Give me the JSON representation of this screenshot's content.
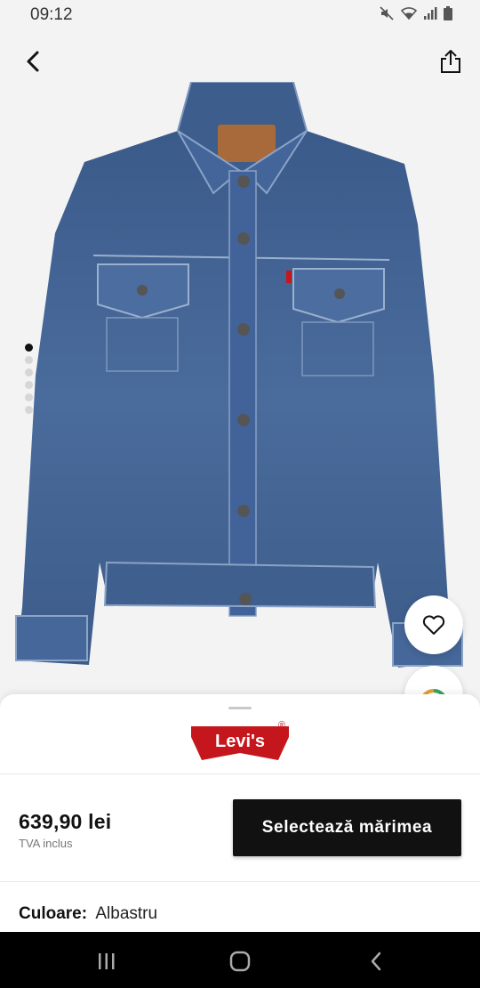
{
  "status_bar": {
    "time": "09:12",
    "icons": [
      "mute-icon",
      "wifi-icon",
      "signal-icon",
      "battery-icon"
    ]
  },
  "top_bar": {
    "back_icon": "chevron-left-icon",
    "share_icon": "share-icon"
  },
  "gallery": {
    "image_count": 6,
    "active_index": 0
  },
  "actions": {
    "favorite_icon": "heart-icon",
    "ar_icon": "view-in-room-icon"
  },
  "product": {
    "brand": "Levi's",
    "brand_mark": "®",
    "price": "639,90 lei",
    "vat_note": "TVA inclus",
    "select_size_label": "Selectează mărimea",
    "color_label": "Culoare:",
    "color_value": "Albastru"
  },
  "colors": {
    "brand_red": "#c4161c",
    "button_bg": "#111111",
    "denim": "#3f5f8e"
  },
  "nav_bar": {
    "icons": [
      "recent-apps-icon",
      "home-icon",
      "back-icon"
    ]
  }
}
